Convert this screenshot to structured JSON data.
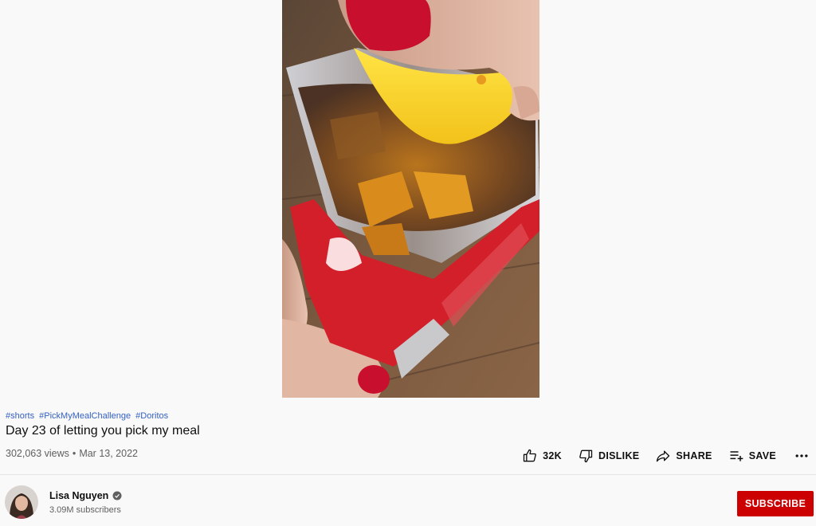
{
  "video": {
    "hashtags": [
      "#shorts",
      "#PickMyMealChallenge",
      "#Doritos"
    ],
    "title": "Day 23 of letting you pick my meal",
    "views": "302,063 views",
    "date": "Mar 13, 2022"
  },
  "actions": {
    "like_count": "32K",
    "dislike_label": "DISLIKE",
    "share_label": "SHARE",
    "save_label": "SAVE"
  },
  "channel": {
    "name": "Lisa Nguyen",
    "subscribers": "3.09M subscribers",
    "subscribe_label": "SUBSCRIBE"
  },
  "colors": {
    "background": "#f9f9f9",
    "subscribe": "#cc0000",
    "hashtag": "#3461c4"
  }
}
